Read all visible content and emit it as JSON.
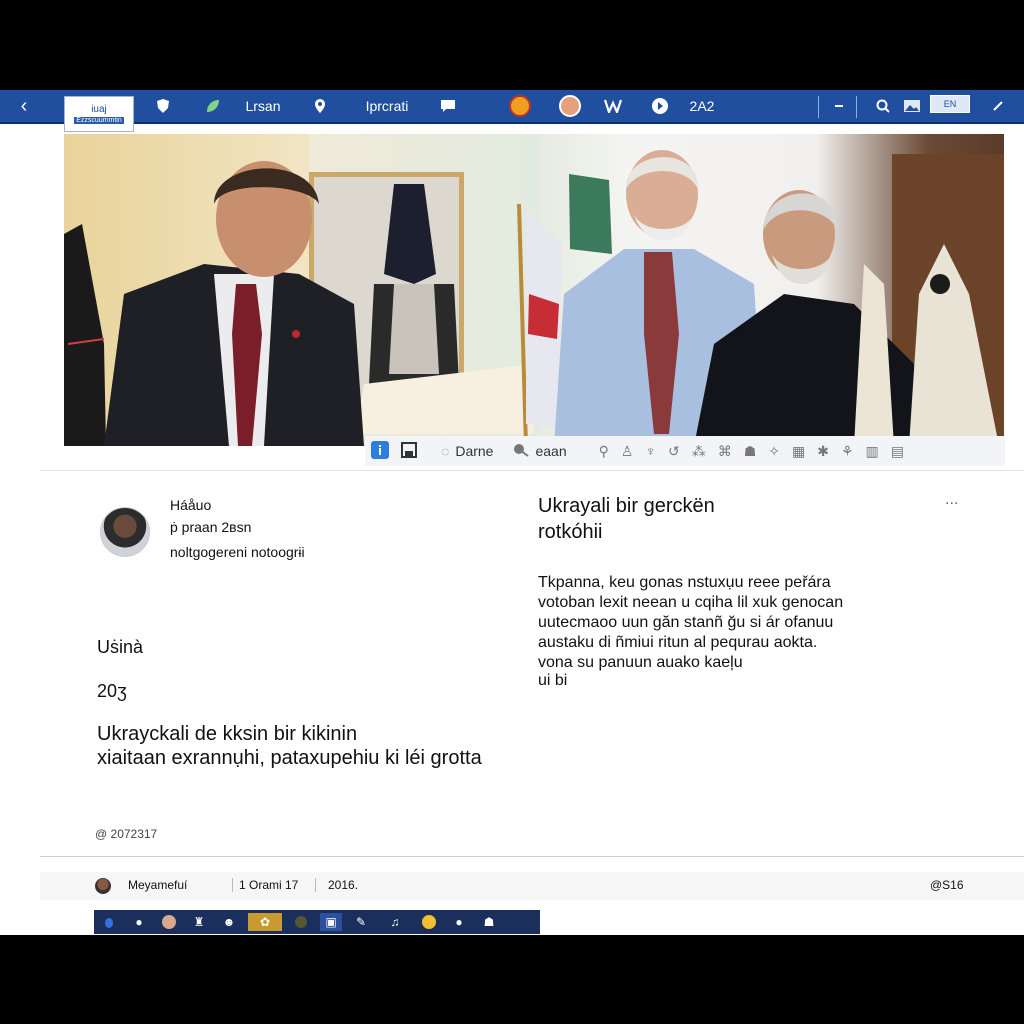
{
  "toolbar": {
    "back_label": "‹",
    "logo_line1": "iuaj",
    "logo_line2": "Ezzscuummtin",
    "link1": "Lrsan",
    "link2": "Iprcrati",
    "counter": "2A2",
    "lang_badge": "EN"
  },
  "photo_toolbar": {
    "name1": "Darne",
    "name2": "eaan"
  },
  "author": {
    "name": "Háåuo",
    "meta": "ṗ praan 2ʙsn",
    "subtitle": "noltgogereni notoogrɨi"
  },
  "post": {
    "section_label": "Uṡinà",
    "year": "20ʒ",
    "caption_line1": "Ukrayckali de kksin bir kikinin",
    "caption_line2": "xiaitaan exrannụhi, pataxupehiu ki léi grotta",
    "copyright": "@ 2072317",
    "headline_line1": "Ukrayali bir gerckën",
    "headline_line2": "rotkóhii",
    "more_label": "...",
    "body_lines": [
      "Tkpanna, keu gonas nstuxụu reee peřára",
      "votoban lexit neean u cqiha lil xuk genocan",
      "uutecmaoo uun găn stanñ ğu si ár ofanuu",
      "austaku di ñmiui ritun al pequrau aokta.",
      "vona su panuun auako kaeļu",
      "ui bi"
    ]
  },
  "footer": {
    "user": "Meyamefuí",
    "views": "1 Orami 17",
    "date": "2016.",
    "code": "@S16"
  },
  "colors": {
    "toolbar_bg": "#1f4f9e",
    "taskbar_bg": "#1b2f5c"
  }
}
